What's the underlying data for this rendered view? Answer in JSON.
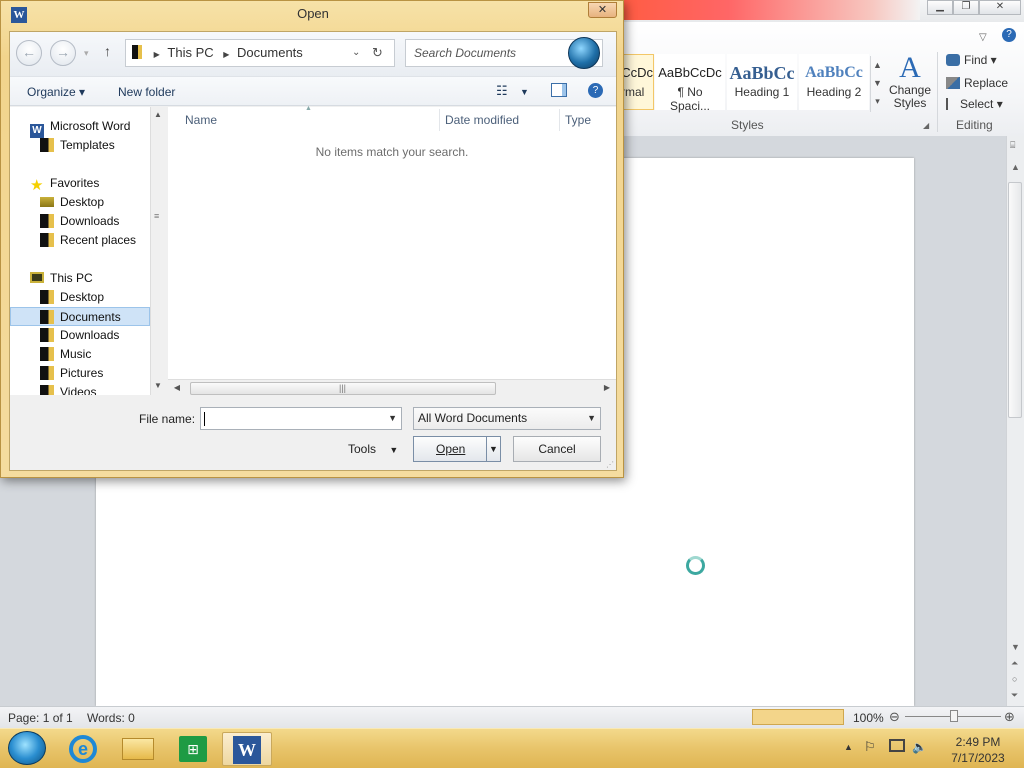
{
  "dialog": {
    "title": "Open",
    "close_glyph": "✕",
    "breadcrumb": [
      "This PC",
      "Documents"
    ],
    "search_placeholder": "Search Documents",
    "toolbar": {
      "organize": "Organize",
      "new_folder": "New folder"
    },
    "tree": {
      "microsoft_word": "Microsoft Word",
      "templates": "Templates",
      "favorites": "Favorites",
      "fav_desktop": "Desktop",
      "fav_downloads": "Downloads",
      "fav_recent": "Recent places",
      "this_pc": "This PC",
      "pc_desktop": "Desktop",
      "pc_documents": "Documents",
      "pc_downloads": "Downloads",
      "pc_music": "Music",
      "pc_pictures": "Pictures",
      "pc_videos": "Videos"
    },
    "columns": {
      "name": "Name",
      "date_modified": "Date modified",
      "type": "Type"
    },
    "empty_message": "No items match your search.",
    "file_name_label": "File name:",
    "file_name_value": "",
    "file_type": "All Word Documents",
    "tools": "Tools",
    "open": "Open",
    "cancel": "Cancel"
  },
  "word": {
    "styles": [
      {
        "preview": "AaBbCcDc",
        "name": "¶ Normal",
        "shown_name": "rmal"
      },
      {
        "preview": "AaBbCcDc",
        "name": "¶ No Spaci..."
      },
      {
        "preview": "AaBbCc",
        "name": "Heading 1"
      },
      {
        "preview": "AaBbCc",
        "name": "Heading 2"
      }
    ],
    "change_styles": "Change Styles",
    "styles_group": "Styles",
    "editing_group": "Editing",
    "find": "Find",
    "replace": "Replace",
    "select": "Select",
    "status": {
      "page": "Page: 1 of 1",
      "words": "Words: 0",
      "zoom": "100%"
    }
  },
  "taskbar": {
    "time": "2:49 PM",
    "date": "7/17/2023"
  },
  "colors": {
    "accent_red": "#ff5a3c",
    "taskbar_gold": "#e8c46a",
    "word_blue": "#2b579a",
    "heading_blue": "#365f91"
  }
}
